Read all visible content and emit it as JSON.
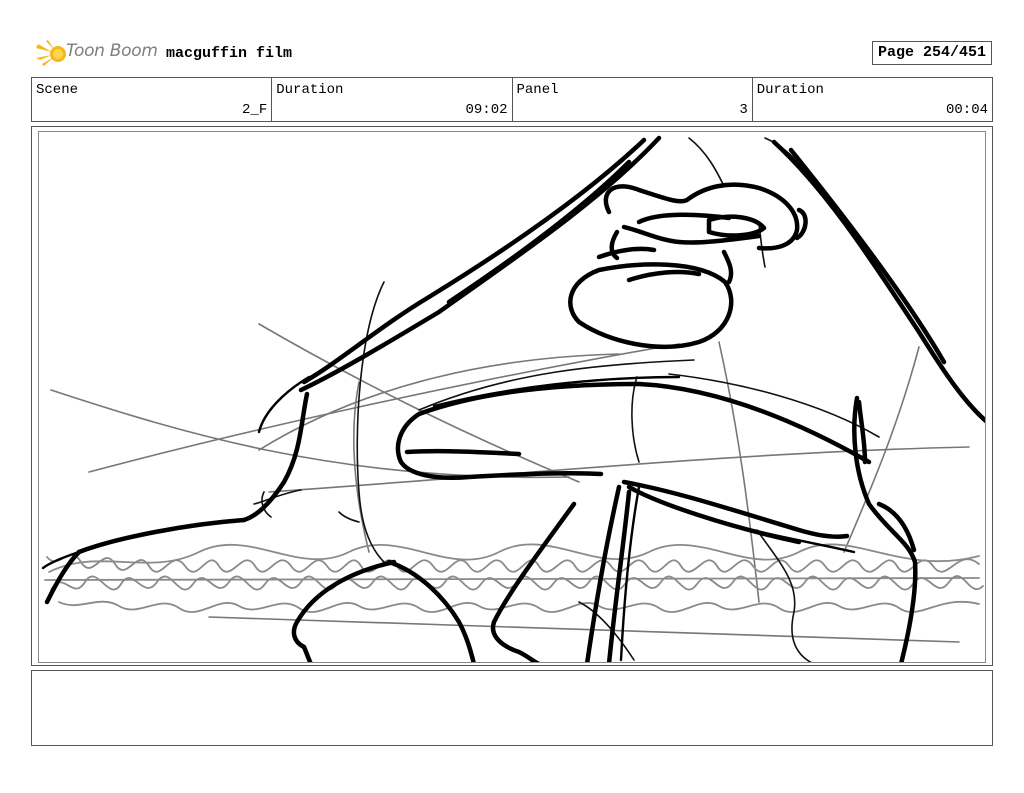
{
  "header": {
    "logo_text": "Toon Boom",
    "film_title": "macguffin film",
    "page_label": "Page 254/451"
  },
  "info": {
    "scene_label": "Scene",
    "scene_value": "2_F",
    "duration_label": "Duration",
    "duration_value": "09:02",
    "panel_label": "Panel",
    "panel_value": "3",
    "panel_duration_label": "Duration",
    "panel_duration_value": "00:04"
  },
  "notes": {
    "text": ""
  }
}
